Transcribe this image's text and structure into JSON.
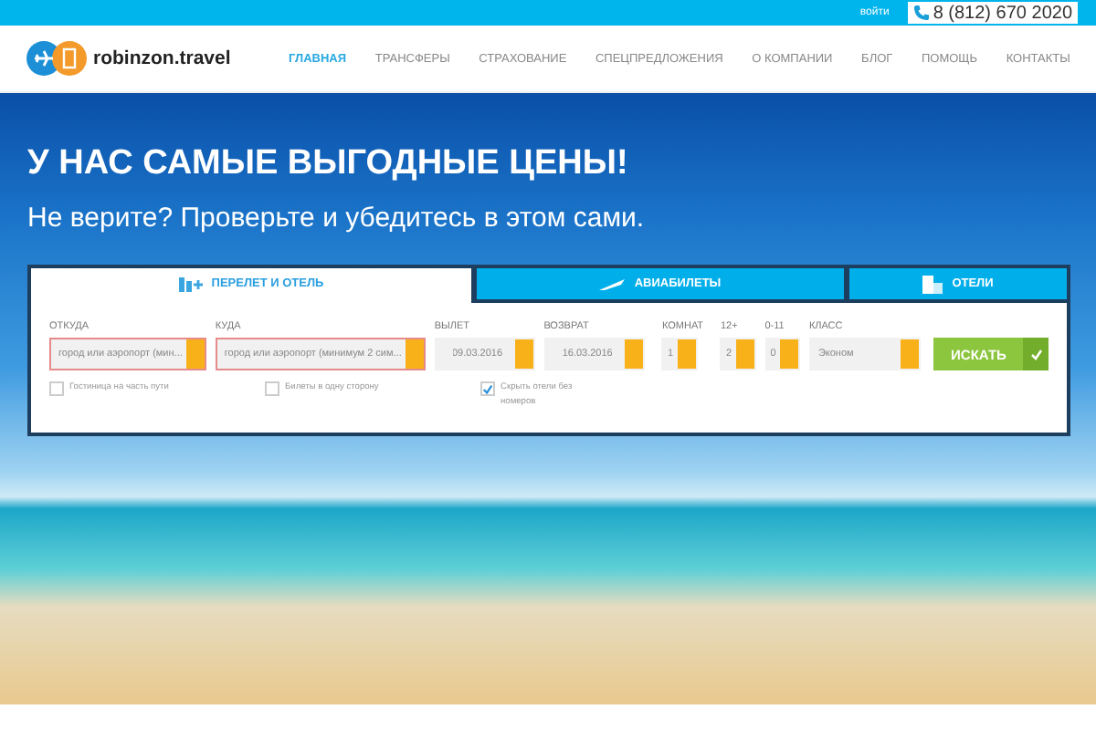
{
  "top_bar": {
    "login": "войти",
    "phone": "8 (812) 670 2020"
  },
  "header": {
    "logo": "robinzon.travel",
    "nav": [
      {
        "label": "ГЛАВНАЯ",
        "selected": true
      },
      {
        "label": "ТРАНСФЕРЫ",
        "selected": false
      },
      {
        "label": "СТРАХОВАНИЕ",
        "selected": false
      },
      {
        "label": "СПЕЦПРЕДЛОЖЕНИЯ",
        "selected": false
      },
      {
        "label": "О КОМПАНИИ",
        "selected": false
      },
      {
        "label": "БЛОГ",
        "selected": false
      },
      {
        "label": "ПОМОЩЬ",
        "selected": false
      },
      {
        "label": "КОНТАКТЫ",
        "selected": false
      }
    ]
  },
  "hero": {
    "title": "У НАС САМЫЕ ВЫГОДНЫЕ ЦЕНЫ!",
    "subtitle": "Не верите? Проверьте и убедитесь в этом сами."
  },
  "search": {
    "tabs": [
      {
        "label": "ПЕРЕЛЕТ И ОТЕЛЬ",
        "selected": true,
        "kind": "combo"
      },
      {
        "label": "АВИАБИЛЕТЫ",
        "selected": false,
        "kind": "plane"
      },
      {
        "label": "ОТЕЛИ",
        "selected": false,
        "kind": "hotel"
      }
    ],
    "fields": [
      {
        "kind": "select",
        "label": "ОТКУДА",
        "placeholder": "город или аэропорт (мин...",
        "error": true
      },
      {
        "kind": "select",
        "label": "КУДА",
        "placeholder": "город или аэропорт (минимум 2 сим...",
        "error": true
      },
      {
        "kind": "date",
        "label": "ВЫЛЕТ",
        "value": "09.03.2016",
        "error": false
      },
      {
        "kind": "date",
        "label": "ВОЗВРАТ",
        "value": "16.03.2016",
        "error": false
      },
      {
        "kind": "count",
        "label": "КОМНАТ",
        "value": "1",
        "error": false
      },
      {
        "kind": "count",
        "label": "12+",
        "value": "2",
        "error": false
      },
      {
        "kind": "count",
        "label": "0-11",
        "value": "0",
        "error": false
      },
      {
        "kind": "select",
        "label": "КЛАСС",
        "value": "Эконом",
        "error": false
      }
    ],
    "button": "ИСКАТЬ",
    "checkboxes": [
      {
        "label": "Гостиница на часть пути",
        "checked": false
      },
      {
        "label": "Билеты в одну сторону",
        "checked": false
      },
      {
        "label": "Скрыть отели без номеров",
        "checked": true
      }
    ]
  }
}
